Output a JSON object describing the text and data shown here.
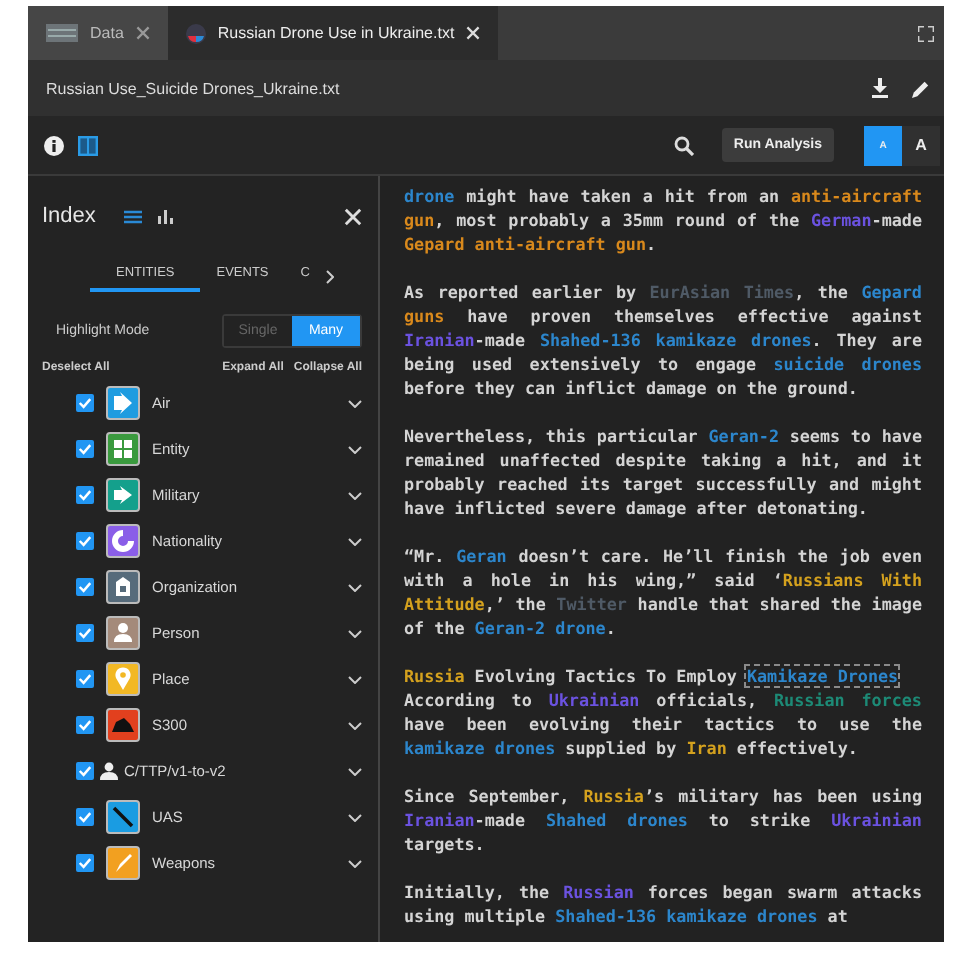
{
  "tabs": [
    {
      "label": "Data",
      "selected": false
    },
    {
      "label": "Russian Drone Use in Ukraine.txt",
      "selected": true
    }
  ],
  "file": {
    "title": "Russian Use_Suicide Drones_Ukraine.txt"
  },
  "toolbar": {
    "run_button": "Run Analysis",
    "size_buttons": [
      {
        "label": "A",
        "kind": "small",
        "selected": true
      },
      {
        "label": "A",
        "kind": "large",
        "selected": false
      }
    ]
  },
  "index": {
    "title": "Index",
    "tabs": [
      {
        "label": "ENTITIES",
        "selected": true
      },
      {
        "label": "EVENTS",
        "selected": false
      },
      {
        "label": "C",
        "selected": false
      }
    ],
    "highlight_mode": {
      "label": "Highlight Mode",
      "options": [
        {
          "label": "Single",
          "selected": false
        },
        {
          "label": "Many",
          "selected": true
        }
      ]
    },
    "actions": [
      "Deselect All",
      "Expand All",
      "Collapse All"
    ],
    "categories": [
      {
        "label": "Air",
        "kind": "category",
        "color": "#1e9ce0",
        "checked": true
      },
      {
        "label": "Entity",
        "kind": "category",
        "color": "#3a9a3e",
        "checked": true
      },
      {
        "label": "Military",
        "kind": "category",
        "color": "#14a08c",
        "checked": true
      },
      {
        "label": "Nationality",
        "kind": "category",
        "color": "#8a5ee8",
        "checked": true
      },
      {
        "label": "Organization",
        "kind": "category",
        "color": "#566b7b",
        "checked": true
      },
      {
        "label": "Person",
        "kind": "category",
        "color": "#a48a7a",
        "checked": true
      },
      {
        "label": "Place",
        "kind": "category",
        "color": "#f2b824",
        "checked": true
      },
      {
        "label": "S300",
        "kind": "category",
        "color": "#e2401e",
        "checked": true
      },
      {
        "label": "C/TTP/v1-to-v2",
        "kind": "plain",
        "checked": true
      },
      {
        "label": "UAS",
        "kind": "category",
        "color": "#1a9ce2",
        "checked": true
      },
      {
        "label": "Weapons",
        "kind": "category",
        "color": "#f2a020",
        "checked": true
      }
    ]
  },
  "document": {
    "paragraphs": [
      {
        "kind": "paragraph",
        "segments": [
          {
            "text": "drone",
            "color": "#2c86cc"
          },
          {
            "text": " might have taken a hit from an "
          },
          {
            "text": "anti-aircraft gun",
            "color": "#d9891c"
          },
          {
            "text": ", most probably a 35mm round of the "
          },
          {
            "text": "German",
            "color": "#6b52e0"
          },
          {
            "text": "-made "
          },
          {
            "text": "Gepard anti-aircraft gun",
            "color": "#d9891c"
          },
          {
            "text": "."
          }
        ]
      },
      {
        "kind": "paragraph",
        "segments": [
          {
            "text": "As reported earlier by "
          },
          {
            "text": "EurAsian Times",
            "color": "#4f5a66"
          },
          {
            "text": ", the "
          },
          {
            "text": "Gepard",
            "color": "#2c86cc"
          },
          {
            "text": " guns",
            "color": "#d9891c"
          },
          {
            "text": " have proven themselves effective against "
          },
          {
            "text": "Iranian",
            "color": "#6b52e0"
          },
          {
            "text": "-made "
          },
          {
            "text": "Shahed-136 kamikaze drones",
            "color": "#2c86cc"
          },
          {
            "text": ". They are being used extensively to engage "
          },
          {
            "text": "suicide drones",
            "color": "#2c86cc"
          },
          {
            "text": " before they can inflict damage on the ground."
          }
        ]
      },
      {
        "kind": "paragraph",
        "segments": [
          {
            "text": "Nevertheless, this particular "
          },
          {
            "text": "Geran-2",
            "color": "#2c86cc"
          },
          {
            "text": " seems to have remained unaffected despite taking a hit, and it probably reached its target successfully and might have inflicted severe damage after detonating."
          }
        ]
      },
      {
        "kind": "paragraph",
        "segments": [
          {
            "text": "“Mr. "
          },
          {
            "text": "Geran",
            "color": "#2c86cc"
          },
          {
            "text": " doesn’t care. He’ll finish the job even with a hole in his wing,” said ‘"
          },
          {
            "text": "Russians With Attitude",
            "color": "#d4a11e"
          },
          {
            "text": ",’ the "
          },
          {
            "text": "Twitter",
            "color": "#4f5a66"
          },
          {
            "text": " handle that shared the image of the "
          },
          {
            "text": "Geran-2 drone",
            "color": "#2c86cc"
          },
          {
            "text": "."
          }
        ]
      },
      {
        "kind": "heading",
        "segments": [
          {
            "text": "Russia",
            "color": "#d4a11e",
            "outlined": false
          },
          {
            "text": " Evolving Tactics To Employ ",
            "outlined": false
          },
          {
            "text": "Kamikaze Drones",
            "color": "#2c86cc",
            "outlined": true
          }
        ]
      },
      {
        "kind": "paragraph",
        "segments": [
          {
            "text": "According to "
          },
          {
            "text": "Ukrainian",
            "color": "#6b52e0"
          },
          {
            "text": " officials, "
          },
          {
            "text": "Russian forces",
            "color": "#1d8a76"
          },
          {
            "text": " have been evolving their tactics to use the "
          },
          {
            "text": "kamikaze drones",
            "color": "#2c86cc"
          },
          {
            "text": " supplied by "
          },
          {
            "text": "Iran",
            "color": "#d4a11e"
          },
          {
            "text": " effectively."
          }
        ]
      },
      {
        "kind": "paragraph",
        "segments": [
          {
            "text": "Since September, "
          },
          {
            "text": "Russia",
            "color": "#d4a11e"
          },
          {
            "text": "’s military has been using "
          },
          {
            "text": "Iranian",
            "color": "#6b52e0"
          },
          {
            "text": "-made "
          },
          {
            "text": "Shahed drones",
            "color": "#2c86cc"
          },
          {
            "text": " to strike "
          },
          {
            "text": "Ukrainian",
            "color": "#6b52e0"
          },
          {
            "text": " targets."
          }
        ]
      },
      {
        "kind": "paragraph",
        "segments": [
          {
            "text": "Initially, the "
          },
          {
            "text": "Russian",
            "color": "#6b52e0"
          },
          {
            "text": " forces began swarm attacks using multiple "
          },
          {
            "text": "Shahed-136 kamikaze drones",
            "color": "#2c86cc"
          },
          {
            "text": " at"
          }
        ]
      }
    ]
  }
}
